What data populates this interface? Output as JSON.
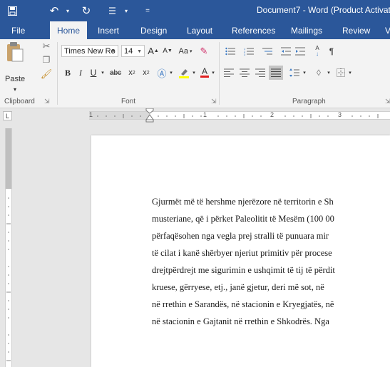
{
  "title_bar": {
    "document_title": "Document7 - Word (Product Activati"
  },
  "tabs": [
    "File",
    "Home",
    "Insert",
    "Design",
    "Layout",
    "References",
    "Mailings",
    "Review",
    "V"
  ],
  "ribbon": {
    "clipboard": {
      "paste_label": "Paste",
      "group_label": "Clipboard"
    },
    "font": {
      "font_name": "Times New Ro",
      "font_size": "14",
      "grow_label": "A",
      "shrink_label": "A",
      "case_label": "Aa",
      "bold_label": "B",
      "italic_label": "I",
      "underline_label": "U",
      "strike_label": "abc",
      "subscript_label": "x",
      "superscript_label": "x",
      "font_color_label": "A",
      "group_label": "Font"
    },
    "paragraph": {
      "sort_label": "A",
      "group_label": "Paragraph"
    }
  },
  "ruler": {
    "numbers": [
      "1",
      "1",
      "2",
      "3"
    ]
  },
  "document": {
    "lines": [
      "Gjurmët më të hershme njerëzore në territorin e Sh",
      "musteriane, që i përket Paleolitit të Mesëm (100 00",
      "përfaqësohen nga vegla prej stralli të punuara mir",
      "të cilat i kanë shërbyer njeriut primitiv për procese",
      "drejtpërdrejt me sigurimin e ushqimit të tij të përdit",
      "kruese, gërryese, etj., janë gjetur, deri më sot, në",
      "në rrethin e Sarandës, në stacionin e Kryegjatës, në",
      "në stacionin e Gajtanit në rrethin e Shkodrës. Nga"
    ]
  },
  "colors": {
    "accent": "#2b579a",
    "ribbon_bg": "#f3f3f3",
    "canvas_bg": "#e6e6e6"
  }
}
